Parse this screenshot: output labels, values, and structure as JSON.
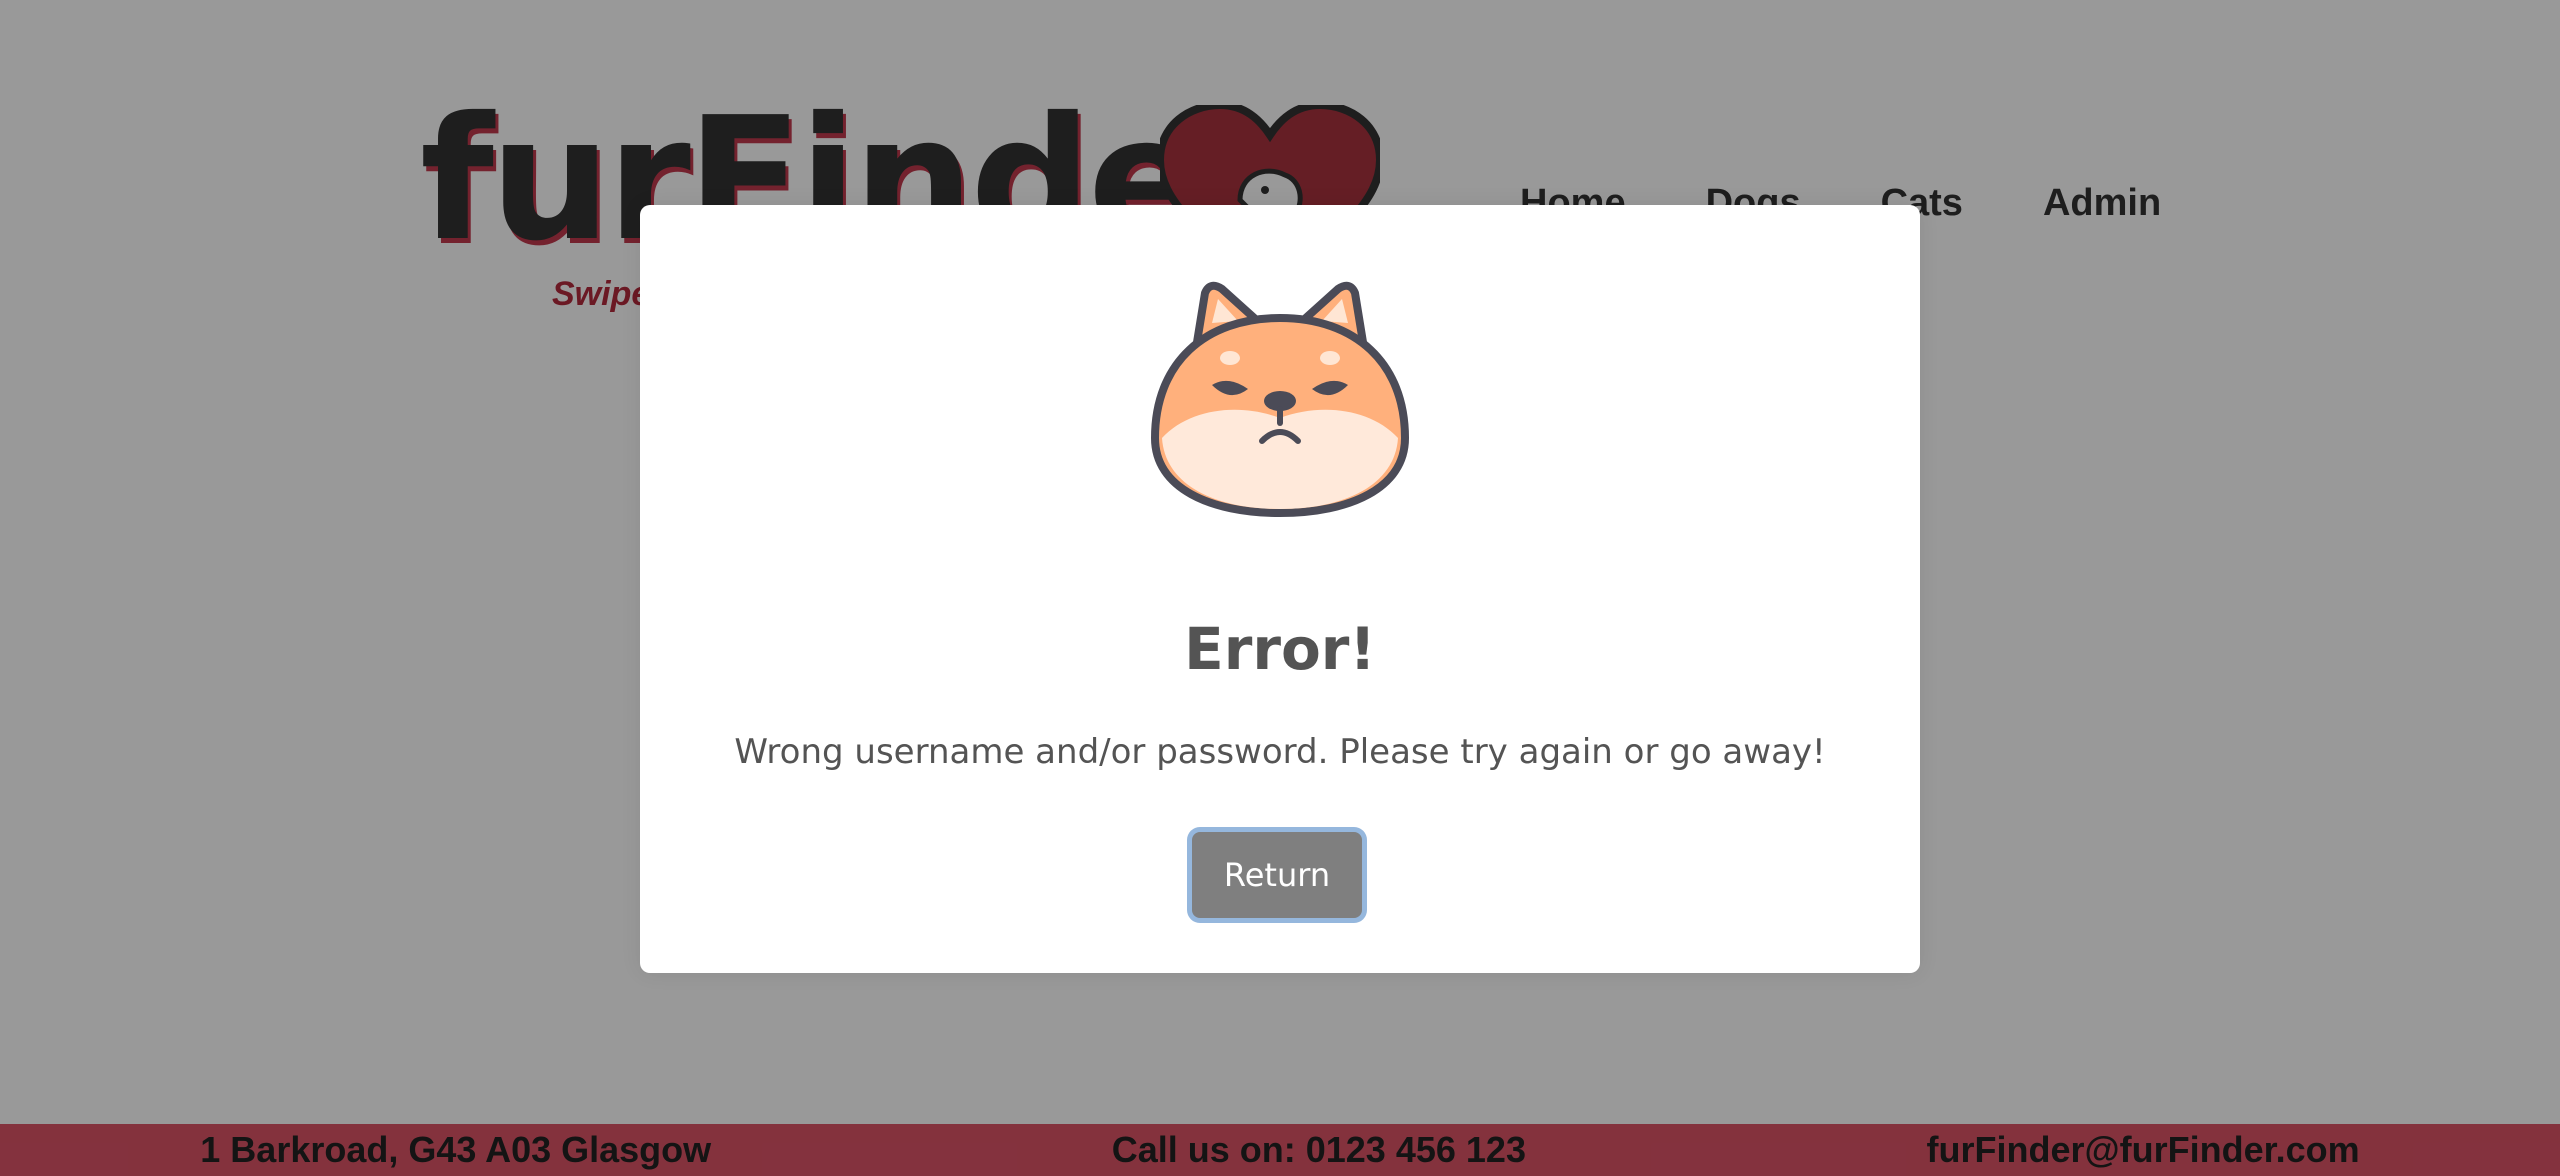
{
  "header": {
    "logo_text": "furFinder",
    "tagline": "Swipe",
    "nav": [
      {
        "label": "Home"
      },
      {
        "label": "Dogs"
      },
      {
        "label": "Cats"
      },
      {
        "label": "Admin"
      }
    ]
  },
  "footer": {
    "address": "1 Barkroad, G43 A03 Glasgow",
    "phone": "Call us on: 0123 456 123",
    "email": "furFinder@furFinder.com"
  },
  "modal": {
    "icon": "angry-shiba-icon",
    "title": "Error!",
    "message": "Wrong username and/or password. Please try again or go away!",
    "button_label": "Return"
  },
  "colors": {
    "brand_red": "#dc5467",
    "overlay": "rgba(0,0,0,0.4)",
    "button_bg": "#7f7f7f",
    "text_dark": "#545454"
  }
}
